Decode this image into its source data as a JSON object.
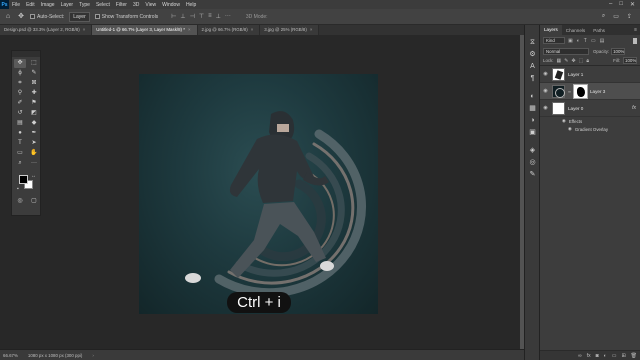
{
  "menubar": {
    "logo": "Ps",
    "items": [
      "File",
      "Edit",
      "Image",
      "Layer",
      "Type",
      "Select",
      "Filter",
      "3D",
      "View",
      "Window",
      "Help"
    ],
    "controls": [
      "–",
      "□",
      "✕"
    ]
  },
  "options": {
    "auto_select_label": "Auto-Select:",
    "auto_select_target": "Layer",
    "transform_label": "Show Transform Controls",
    "mode3d_label": "3D Mode:"
  },
  "tabs": [
    {
      "label": "Design.psd @ 33.3% (Layer 2, RGB/8)",
      "active": false
    },
    {
      "label": "Untitled-1 @ 66.7% (Layer 3, Layer Mask/8) *",
      "active": true
    },
    {
      "label": "2.jpg @ 66.7% (RGB/8)",
      "active": false
    },
    {
      "label": "3.jpg @ 25% (RGB/8)",
      "active": false
    }
  ],
  "caption": "Ctrl + i",
  "status": {
    "zoom": "66.67%",
    "doc_info": "1080 px x 1080 px (300 ppi)"
  },
  "layers_panel": {
    "tabs": [
      "Layers",
      "Channels",
      "Paths"
    ],
    "kind": "Kind",
    "blend_mode": "Normal",
    "opacity_label": "Opacity:",
    "opacity_value": "100%",
    "lock_label": "Lock:",
    "fill_label": "Fill:",
    "fill_value": "100%",
    "layers": [
      {
        "name": "Layer 1",
        "selected": false
      },
      {
        "name": "Layer 3",
        "selected": true
      },
      {
        "name": "Layer 0",
        "selected": false,
        "fx": "fx"
      }
    ],
    "effects_label": "Effects",
    "effect_item": "Gradient Overlay"
  },
  "colors": {
    "accent": "#31a8ff",
    "canvas_bg": "#1e3a3f"
  }
}
